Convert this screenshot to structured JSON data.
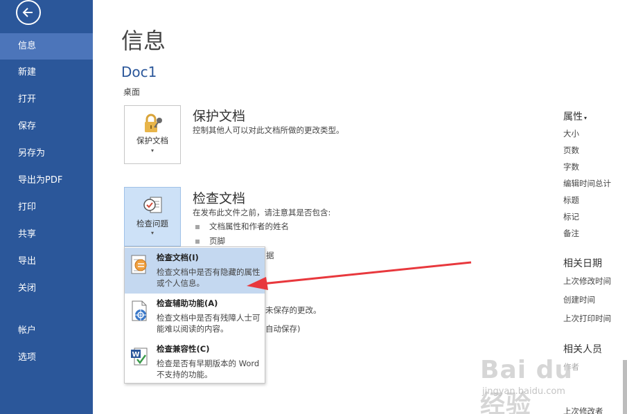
{
  "colors": {
    "sidebar": "#2b579a",
    "sidebar_active": "#4c75ba",
    "accent_text": "#2b579a",
    "highlight": "#c4d8f0",
    "arrow": "#e8383d"
  },
  "sidebar": {
    "back_icon": "back-arrow-icon",
    "items": [
      {
        "label": "信息",
        "active": true
      },
      {
        "label": "新建"
      },
      {
        "label": "打开"
      },
      {
        "label": "保存"
      },
      {
        "label": "另存为"
      },
      {
        "label": "导出为PDF"
      },
      {
        "label": "打印"
      },
      {
        "label": "共享"
      },
      {
        "label": "导出"
      },
      {
        "label": "关闭"
      },
      {
        "label": "帐户"
      },
      {
        "label": "选项"
      }
    ]
  },
  "main": {
    "title": "信息",
    "doc_name": "Doc1",
    "doc_location": "桌面",
    "protect": {
      "tile_label": "保护文档",
      "caret": "▾",
      "title": "保护文档",
      "desc": "控制其他人可以对此文档所做的更改类型。"
    },
    "inspect": {
      "tile_label": "检查问题",
      "caret": "▾",
      "title": "检查文档",
      "desc": "在发布此文件之前，请注意其是否包含:",
      "bullets": [
        "文档属性和作者的姓名",
        "页脚"
      ],
      "partial_1": "据",
      "partial_2": "未保存的更改。",
      "partial_3": "自动保存)"
    },
    "dropdown": [
      {
        "title": "检查文档(I)",
        "desc": "检查文档中是否有隐藏的属性或个人信息。",
        "icon": "inspect-document-icon"
      },
      {
        "title": "检查辅助功能(A)",
        "desc": "检查文档中是否有残障人士可能难以阅读的内容。",
        "icon": "accessibility-checker-icon"
      },
      {
        "title": "检查兼容性(C)",
        "desc": "检查是否有早期版本的 Word 不支持的功能。",
        "icon": "compatibility-checker-icon"
      }
    ]
  },
  "properties": {
    "header": "属性",
    "header_caret": "▾",
    "items": [
      "大小",
      "页数",
      "字数",
      "编辑时间总计",
      "标题",
      "标记",
      "备注"
    ],
    "dates_header": "相关日期",
    "dates": [
      "上次修改时间",
      "创建时间",
      "上次打印时间"
    ],
    "people_header": "相关人员",
    "people_partial_1": "作者",
    "people_partial_2": "上次修改者"
  },
  "watermark": {
    "logo": "Bai du 经验",
    "url": "jingyan.baidu.com"
  }
}
